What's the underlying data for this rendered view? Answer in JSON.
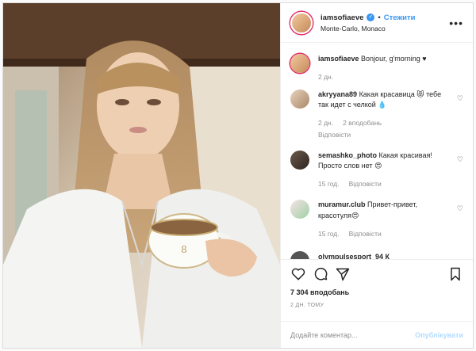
{
  "header": {
    "username": "iamsofiaeve",
    "follow_label": "Стежити",
    "location": "Monte-Carlo, Monaco",
    "more_label": "•••"
  },
  "caption": {
    "username": "iamsofiaeve",
    "text": "Bonjour, g'morning ♥",
    "age": "2 дн."
  },
  "comments": [
    {
      "username": "akryyana89",
      "text": "Какая красавица 😻 тебе так идет с челкой 💧",
      "age": "2 дн.",
      "likes": "2 вподобань",
      "reply": "Відповісти"
    },
    {
      "username": "semashko_photo",
      "text": "Какая красивая! Просто слов нет 😍",
      "age": "15 год.",
      "reply": "Відповісти"
    },
    {
      "username": "muramur.club",
      "text": "Привет-привет, красотуля😍",
      "age": "15 год.",
      "reply": "Відповісти"
    }
  ],
  "partial_comment": "olympulsesport_94 К",
  "actions": {
    "likes": "7 304 вподобань",
    "timestamp": "2 ДН. ТОМУ"
  },
  "add_comment": {
    "placeholder": "Додайте коментар...",
    "publish_label": "Опублікувати"
  },
  "colors": {
    "accent": "#3897f0",
    "publish_disabled": "#b3dbff",
    "muted": "#8e8e8e"
  },
  "icons": [
    "verified-icon",
    "more-icon",
    "heart-icon",
    "comment-icon",
    "share-icon",
    "bookmark-icon"
  ]
}
